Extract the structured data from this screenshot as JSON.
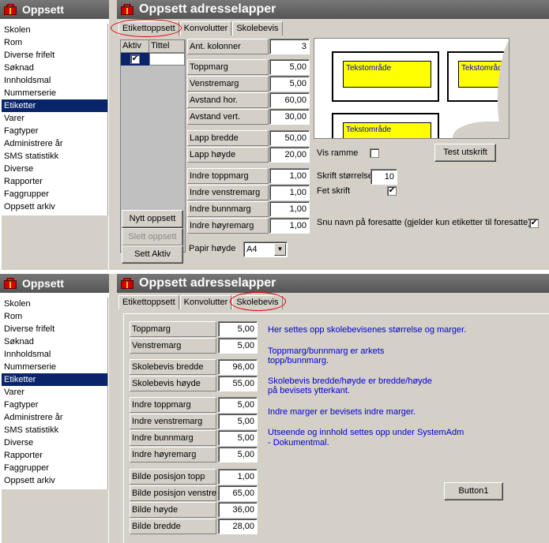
{
  "top": {
    "sidebar_title": "Oppsett",
    "window_title": "Oppsett adresselapper",
    "nav_items": [
      "Skolen",
      "Rom",
      "Diverse frifelt",
      "Søknad",
      "Innholdsmal",
      "Nummerserie",
      "Etiketter",
      "Varer",
      "Fagtyper",
      "Administrere år",
      "SMS statistikk",
      "Diverse",
      "Rapporter",
      "Faggrupper",
      "Oppsett arkiv"
    ],
    "selected_nav": "Etiketter",
    "tabs": [
      "Etikettoppsett",
      "Konvolutter",
      "Skolebevis"
    ],
    "active_tab": "Etikettoppsett",
    "grid": {
      "col_active": "Aktiv",
      "col_title": "Tittel",
      "row_checked": true
    },
    "buttons": {
      "new": "Nytt oppsett",
      "delete": "Slett oppsett",
      "activate": "Sett Aktiv",
      "test_print": "Test utskrift"
    },
    "fields": [
      {
        "label": "Ant. kolonner",
        "value": "3"
      },
      {
        "label": "Toppmarg",
        "value": "5,00"
      },
      {
        "label": "Venstremarg",
        "value": "5,00"
      },
      {
        "label": "Avstand hor.",
        "value": "60,00"
      },
      {
        "label": "Avstand vert.",
        "value": "30,00"
      },
      {
        "label": "Lapp bredde",
        "value": "50,00"
      },
      {
        "label": "Lapp høyde",
        "value": "20,00"
      },
      {
        "label": "Indre toppmarg",
        "value": "1,00"
      },
      {
        "label": "Indre venstremarg",
        "value": "1,00"
      },
      {
        "label": "Indre bunnmarg",
        "value": "1,00"
      },
      {
        "label": "Indre høyremarg",
        "value": "1,00"
      }
    ],
    "paper_label": "Papir høyde",
    "paper_value": "A4",
    "preview_text": [
      "Tekstområde",
      "Tekstområde",
      "Tekstområde"
    ],
    "vis_ramme": "Vis ramme",
    "font_size_label": "Skrift størrelse",
    "font_size_value": "10",
    "bold_label": "Fet skrift",
    "flip_label": "Snu navn på foresatte (gjelder kun etiketter til foresatte)"
  },
  "bottom": {
    "sidebar_title": "Oppsett",
    "window_title": "Oppsett adresselapper",
    "nav_items": [
      "Skolen",
      "Rom",
      "Diverse frifelt",
      "Søknad",
      "Innholdsmal",
      "Nummerserie",
      "Etiketter",
      "Varer",
      "Fagtyper",
      "Administrere år",
      "SMS statistikk",
      "Diverse",
      "Rapporter",
      "Faggrupper",
      "Oppsett arkiv"
    ],
    "selected_nav": "Etiketter",
    "tabs": [
      "Etikettoppsett",
      "Konvolutter",
      "Skolebevis"
    ],
    "active_tab": "Skolebevis",
    "fields": [
      {
        "label": "Toppmarg",
        "value": "5,00"
      },
      {
        "label": "Venstremarg",
        "value": "5,00"
      },
      {
        "label": "Skolebevis bredde",
        "value": "96,00"
      },
      {
        "label": "Skolebevis høyde",
        "value": "55,00"
      },
      {
        "label": "Indre toppmarg",
        "value": "5,00"
      },
      {
        "label": "Indre venstremarg",
        "value": "5,00"
      },
      {
        "label": "Indre bunnmarg",
        "value": "5,00"
      },
      {
        "label": "Indre høyremarg",
        "value": "5,00"
      },
      {
        "label": "Bilde posisjon topp",
        "value": "1,00"
      },
      {
        "label": "Bilde posisjon venstre",
        "value": "65,00"
      },
      {
        "label": "Bilde høyde",
        "value": "36,00"
      },
      {
        "label": "Bilde bredde",
        "value": "28,00"
      }
    ],
    "help": [
      "Her settes opp skolebevisenes størrelse og marger.",
      "Toppmarg/bunnmarg er arkets",
      "topp/bunnmarg.",
      "Skolebevis bredde/høyde er bredde/høyde",
      "på bevisets ytterkant.",
      "Indre marger er bevisets indre marger.",
      "Utseende og innhold settes opp under SystemAdm",
      "- Dokumentmal."
    ],
    "button1": "Button1"
  },
  "colors": {
    "selection": "#0a246a",
    "highlight_ring": "#dd0000",
    "preview_box": "#ffff00",
    "help_text": "#0000cc"
  }
}
